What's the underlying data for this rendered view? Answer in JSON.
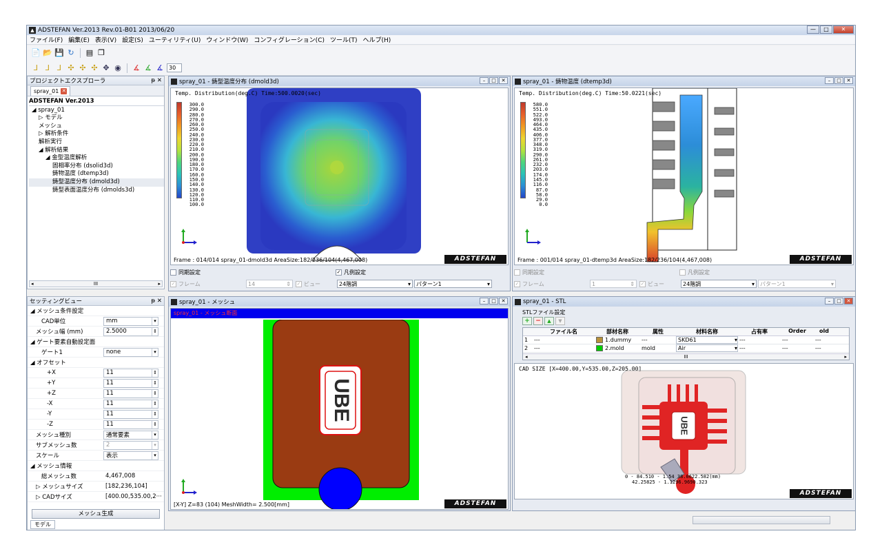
{
  "window": {
    "title": "ADSTEFAN Ver.2013 Rev.01-B01 2013/06/20"
  },
  "menu": [
    "ファイル(F)",
    "編集(E)",
    "表示(V)",
    "設定(S)",
    "ユーティリティ(U)",
    "ウィンドウ(W)",
    "コンフィグレーション(C)",
    "ツール(T)",
    "ヘルプ(H)"
  ],
  "toolbar": {
    "layer_value": "30"
  },
  "project": {
    "header": "プロジェクトエクスプローラ",
    "tab": "spray_01",
    "root": "ADSTEFAN Ver.2013",
    "items": [
      {
        "label": "spray_01",
        "indent": 0,
        "mark": "◢"
      },
      {
        "label": "モデル",
        "indent": 1,
        "mark": "▷"
      },
      {
        "label": "メッシュ",
        "indent": 1,
        "mark": ""
      },
      {
        "label": "解析条件",
        "indent": 1,
        "mark": "▷"
      },
      {
        "label": "解析実行",
        "indent": 1,
        "mark": ""
      },
      {
        "label": "解析結果",
        "indent": 1,
        "mark": "◢"
      },
      {
        "label": "金型温度解析",
        "indent": 2,
        "mark": "◢"
      },
      {
        "label": "固相率分布 (dsolid3d)",
        "indent": 3,
        "mark": ""
      },
      {
        "label": "鋳物温度 (dtemp3d)",
        "indent": 3,
        "mark": ""
      },
      {
        "label": "鋳型温度分布 (dmold3d)",
        "indent": 3,
        "mark": "",
        "selected": true
      },
      {
        "label": "鋳型表面温度分布 (dmolds3d)",
        "indent": 3,
        "mark": ""
      }
    ],
    "scroll_label": "III"
  },
  "settings": {
    "header": "セッティングビュー",
    "rows": [
      {
        "k": "◢ メッシュ条件設定",
        "indent": 0
      },
      {
        "k": "CAD単位",
        "v": "mm",
        "type": "dd",
        "indent": 2
      },
      {
        "k": "メッシュ幅 (mm)",
        "v": "2.5000",
        "type": "spin",
        "indent": 1
      },
      {
        "k": "◢ ゲート要素自動設定面",
        "indent": 0
      },
      {
        "k": "ゲート1",
        "v": "none",
        "type": "dd",
        "indent": 2
      },
      {
        "k": "◢ オフセット",
        "indent": 0
      },
      {
        "k": "+X",
        "v": "11",
        "type": "spin",
        "indent": 3
      },
      {
        "k": "+Y",
        "v": "11",
        "type": "spin",
        "indent": 3
      },
      {
        "k": "+Z",
        "v": "11",
        "type": "spin",
        "indent": 3
      },
      {
        "k": "-X",
        "v": "11",
        "type": "spin",
        "indent": 3
      },
      {
        "k": "-Y",
        "v": "11",
        "type": "spin",
        "indent": 3
      },
      {
        "k": "-Z",
        "v": "11",
        "type": "spin",
        "indent": 3
      },
      {
        "k": "メッシュ種別",
        "v": "通常要素",
        "type": "dd",
        "indent": 1
      },
      {
        "k": "サブメッシュ数",
        "v": "2",
        "type": "dis",
        "indent": 1
      },
      {
        "k": "スケール",
        "v": "表示",
        "type": "dd",
        "indent": 1
      },
      {
        "k": "◢ メッシュ情報",
        "indent": 0
      },
      {
        "k": "総メッシュ数",
        "v": "4,467,008",
        "type": "text",
        "indent": 2
      },
      {
        "k": "▷ メッシュサイズ",
        "v": "[182,236,104]",
        "type": "text",
        "indent": 1
      },
      {
        "k": "▷ CADサイズ",
        "v": "[400.00,535.00,2···",
        "type": "text",
        "indent": 1
      }
    ],
    "button": "メッシュ生成",
    "tab": "モデル"
  },
  "win_mold": {
    "title": "spray_01 - 鋳型温度分布 (dmold3d)",
    "header": "Temp. Distribution(deg.C)     Time:500.0020(sec)",
    "legend": [
      "300.0",
      "290.0",
      "280.0",
      "270.0",
      "260.0",
      "250.0",
      "240.0",
      "230.0",
      "220.0",
      "210.0",
      "200.0",
      "190.0",
      "180.0",
      "170.0",
      "160.0",
      "150.0",
      "140.0",
      "130.0",
      "120.0",
      "110.0",
      "100.0"
    ],
    "frame": "Frame : 014/014  spray_01-dmold3d  AreaSize:182/236/104(4,467,008)",
    "brand": "ADSTEFAN",
    "sync": "同期設定",
    "legend_cb": "凡例設定",
    "frame_lbl": "フレーム",
    "frame_val": "14",
    "view_lbl": "ビュー",
    "grad": "24階調",
    "pattern": "パターン1"
  },
  "win_temp": {
    "title": "spray_01 - 鋳物温度 (dtemp3d)",
    "header": "Temp. Distribution(deg.C)     Time:50.0221(sec)",
    "legend": [
      "580.0",
      "551.0",
      "522.0",
      "493.0",
      "464.0",
      "435.0",
      "406.0",
      "377.0",
      "348.0",
      "319.0",
      "290.0",
      "261.0",
      "232.0",
      "203.0",
      "174.0",
      "145.0",
      "116.0",
      "87.0",
      "58.0",
      "29.0",
      "0.0"
    ],
    "frame": "Frame : 001/014  spray_01-dtemp3d  AreaSize:182/236/104(4,467,008)",
    "brand": "ADSTEFAN",
    "sync": "同期設定",
    "legend_cb": "凡例設定",
    "frame_lbl": "フレーム",
    "frame_val": "1",
    "view_lbl": "ビュー",
    "grad": "24階調",
    "pattern": "パターン1"
  },
  "win_mesh": {
    "title": "spray_01 - メッシュ",
    "band": "spray_01 - メッシュ断面",
    "logo": "UBE",
    "status": "[X-Y] Z=83 (104)  MeshWidth= 2.500[mm]",
    "brand": "ADSTEFAN"
  },
  "win_stl": {
    "title": "spray_01 - STL",
    "settings": "STLファイル設定",
    "columns": [
      "",
      "ファイル名",
      "部材名称",
      "属性",
      "材料名称",
      "占有率",
      "Order",
      "old"
    ],
    "rows": [
      {
        "no": "1",
        "file": "---",
        "part": "1.dummy",
        "swatch": "#b8913a",
        "attr": "---",
        "mat": "SKD61",
        "occ": "---",
        "order": "---",
        "old": "---"
      },
      {
        "no": "2",
        "file": "---",
        "part": "2.mold",
        "swatch": "#00cc00",
        "attr": "mold",
        "mat": "Air",
        "occ": "---",
        "order": "---",
        "old": "---"
      }
    ],
    "cad": "CAD SIZE  [X=400.00,Y=535.00,Z=205.00]",
    "dim1": "0 - 84.510 - 1.54  38.0622.582(mm)",
    "dim2": "42.25825 - 1.1296.9690.323",
    "logo": "UBE",
    "brand": "ADSTEFAN"
  },
  "colors": {
    "accent_red": "#e02424",
    "mesh_brown": "#9a3b12",
    "mesh_green": "#00ee00",
    "mesh_blue": "#0000ff"
  }
}
